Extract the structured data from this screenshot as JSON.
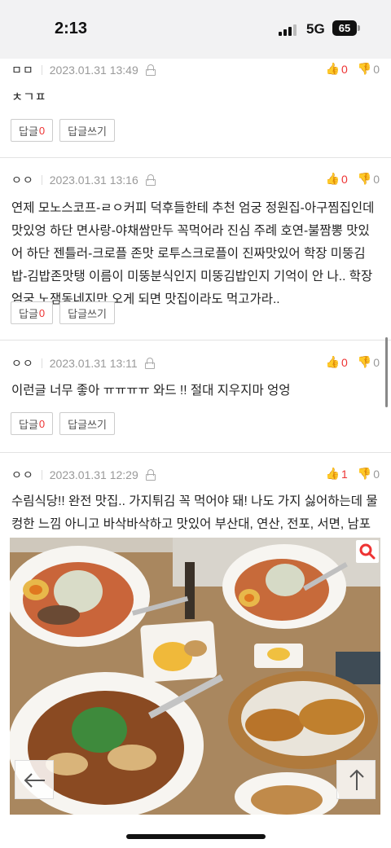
{
  "status": {
    "time": "2:13",
    "network": "5G",
    "battery": "65"
  },
  "comments": [
    {
      "author": "ㅁㅁ",
      "date": "2023.01.31 13:49",
      "up": "0",
      "down": "0",
      "text": "ㅊㄱㅍ",
      "reply_label": "답글",
      "reply_count": "0",
      "write_reply": "답글쓰기"
    },
    {
      "author": "ㅇㅇ",
      "date": "2023.01.31 13:16",
      "up": "0",
      "down": "0",
      "text": "연제 모노스코프-ㄹㅇ커피 덕후들한테 추천 엄궁 정원집-아구찜집인데 맛있엉 하단 면사랑-야채쌈만두 꼭먹어라 진심 주례 호연-불짬뽕 맛있어 하단 젠틀러-크로플 존맛 로투스크로플이 진짜맛있어 학장 미뚱김밥-김밥존맛탱 이름이 미뚱분식인지 미뚱김밥인지 기억이 안 나.. 학장엄궁 노잼동네지만 오게 되면 맛집이라도 먹고가라..",
      "reply_label": "답글",
      "reply_count": "0",
      "write_reply": "답글쓰기"
    },
    {
      "author": "ㅇㅇ",
      "date": "2023.01.31 13:11",
      "up": "0",
      "down": "0",
      "text": "이런글 너무 좋아 ㅠㅠㅠㅠ 와드 !! 절대 지우지마 엉엉",
      "reply_label": "답글",
      "reply_count": "0",
      "write_reply": "답글쓰기"
    },
    {
      "author": "ㅇㅇ",
      "date": "2023.01.31 12:29",
      "up": "1",
      "down": "0",
      "text": "수림식당!! 완전 맛집.. 가지튀김 꼭 먹어야 돼! 나도 가지 싫어하는데 물컹한 느낌 아니고 바삭바삭하고 맛있어 부산대, 연산, 전포, 서면, 남포 등등 있음"
    }
  ],
  "icons": {
    "lock": "lock-icon",
    "thumb_up": "thumbs-up-icon",
    "thumb_down": "thumbs-down-icon",
    "zoom": "search-icon",
    "back": "arrow-left-icon",
    "top": "arrow-up-icon"
  },
  "colors": {
    "accent": "#e33333",
    "muted": "#999999"
  }
}
